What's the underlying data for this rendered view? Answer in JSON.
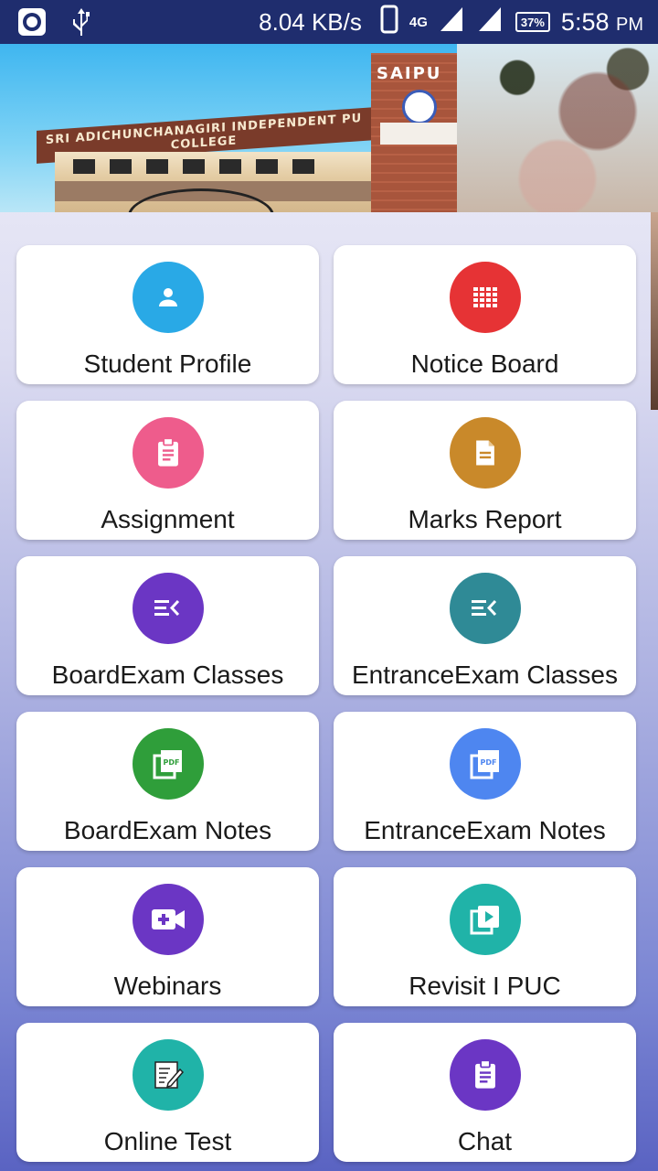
{
  "status_bar": {
    "speed": "8.04 KB/s",
    "network": "4G",
    "sim1": "1",
    "sim2": "2",
    "battery": "37%",
    "time": "5:58",
    "ampm": "PM"
  },
  "banner": {
    "college_sign": "SRI ADICHUNCHANAGIRI INDEPENDENT PU COLLEGE",
    "tower_sign": "SAIPU"
  },
  "menu": [
    {
      "label": "Student Profile",
      "icon": "person-icon",
      "color": "#29a9e6"
    },
    {
      "label": "Notice Board",
      "icon": "grid-icon",
      "color": "#e63335"
    },
    {
      "label": "Assignment",
      "icon": "clipboard-icon",
      "color": "#ee5c8c"
    },
    {
      "label": "Marks Report",
      "icon": "document-icon",
      "color": "#c9892a"
    },
    {
      "label": "BoardExam Classes",
      "icon": "menu-collapse-icon",
      "color": "#6b36c4"
    },
    {
      "label": "EntranceExam Classes",
      "icon": "menu-collapse-icon",
      "color": "#2f8a96"
    },
    {
      "label": "BoardExam Notes",
      "icon": "pdf-icon",
      "color": "#2f9e3a"
    },
    {
      "label": "EntranceExam Notes",
      "icon": "pdf-icon",
      "color": "#4e86f0"
    },
    {
      "label": "Webinars",
      "icon": "video-add-icon",
      "color": "#6b36c4"
    },
    {
      "label": "Revisit I PUC",
      "icon": "video-library-icon",
      "color": "#20b3a8"
    },
    {
      "label": "Online Test",
      "icon": "edit-note-icon",
      "color": "#20b3a8"
    },
    {
      "label": "Chat",
      "icon": "clipboard-icon",
      "color": "#6b36c4"
    }
  ]
}
